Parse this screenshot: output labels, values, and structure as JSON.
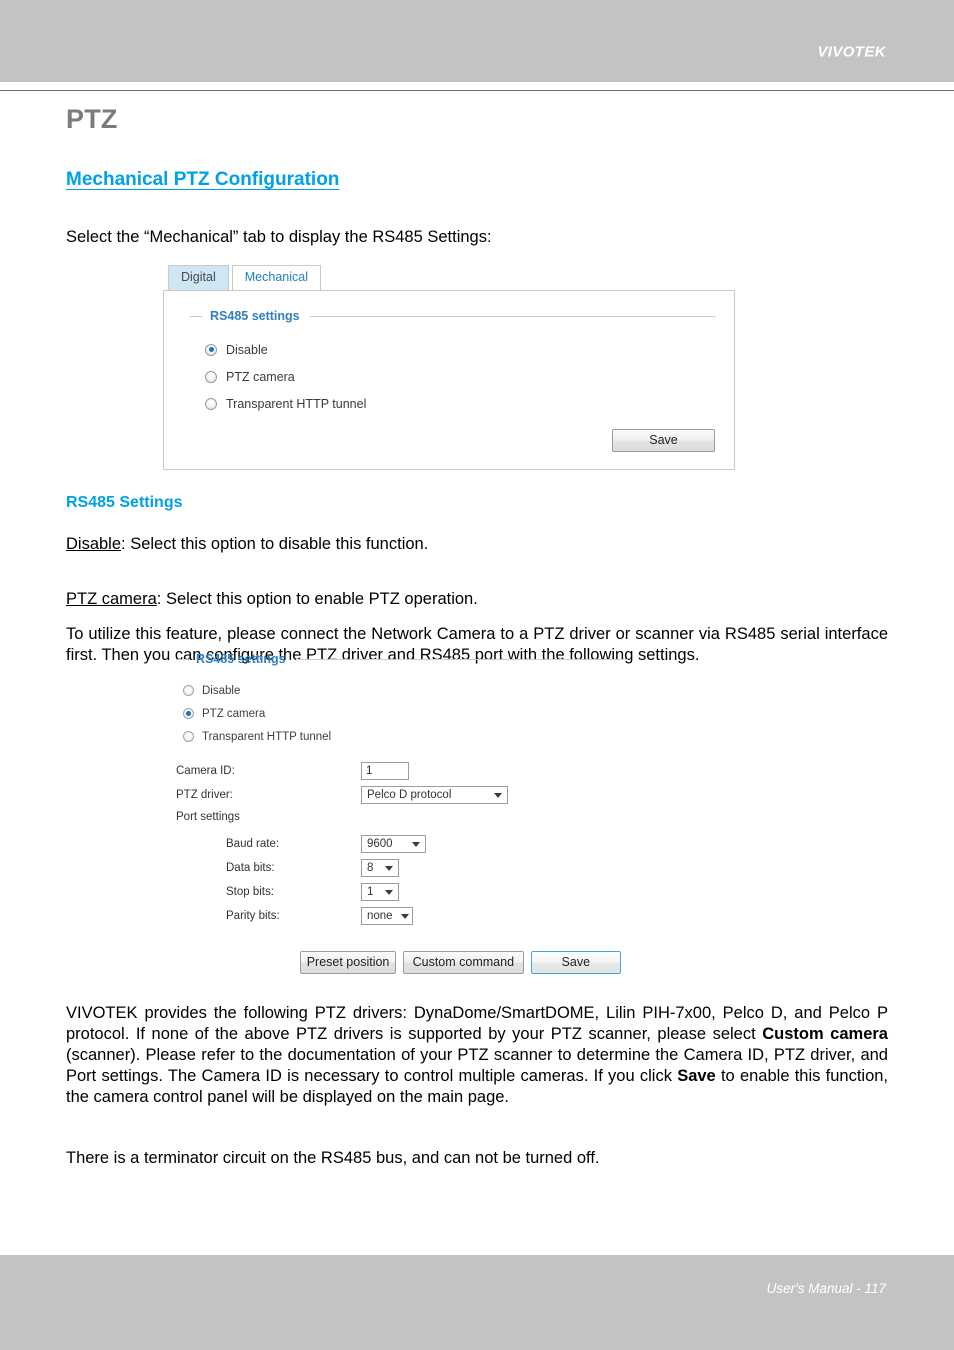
{
  "header": {
    "brand": "VIVOTEK"
  },
  "footer": {
    "text": "User's Manual - 117"
  },
  "content": {
    "page_title": "PTZ",
    "section_link": "Mechanical PTZ Configuration",
    "intro_text": "Select the “Mechanical” tab to display the RS485 Settings:",
    "sub_heading": "RS485 Settings",
    "para_disable_term": "Disable",
    "para_disable_rest": ": Select this option to disable this function.",
    "para_ptz_term": "PTZ camera",
    "para_ptz_rest": ": Select this option to enable PTZ operation.",
    "para_ptz_cont": "To utilize this feature, please connect the Network Camera to a PTZ driver or scanner via RS485 serial interface first. Then you can configure the PTZ driver and RS485 port with the following settings.",
    "para_drivers_1": "VIVOTEK provides the following PTZ drivers: DynaDome/SmartDOME, Lilin PIH-7x00, Pelco D, and Pelco P protocol. If none of the above PTZ drivers is supported by your PTZ scanner, please select ",
    "para_drivers_bold1": "Custom camera",
    "para_drivers_2": " (scanner). Please refer to the documentation of your PTZ scanner to determine the Camera ID, PTZ driver, and Port settings. The Camera ID is necessary to control multiple cameras. If you click ",
    "para_drivers_bold2": "Save",
    "para_drivers_3": " to enable this function, the camera control panel will be displayed on the main page.",
    "para_terminator": "There is a terminator circuit on the RS485 bus, and can not be turned off."
  },
  "widget1": {
    "tabs": [
      {
        "label": "Digital",
        "active": false
      },
      {
        "label": "Mechanical",
        "active": true
      }
    ],
    "fieldset_label": "RS485 settings",
    "radios": [
      {
        "label": "Disable",
        "checked": true
      },
      {
        "label": "PTZ camera",
        "checked": false
      },
      {
        "label": "Transparent HTTP tunnel",
        "checked": false
      }
    ],
    "save_label": "Save"
  },
  "widget2": {
    "fieldset_label": "RS485 settings",
    "radios": [
      {
        "label": "Disable",
        "checked": false
      },
      {
        "label": "PTZ camera",
        "checked": true
      },
      {
        "label": "Transparent HTTP tunnel",
        "checked": false
      }
    ],
    "camera_id_label": "Camera ID:",
    "camera_id_value": "1",
    "ptz_driver_label": "PTZ driver:",
    "ptz_driver_value": "Pelco D protocol",
    "port_settings_label": "Port settings",
    "baud_rate_label": "Baud rate:",
    "baud_rate_value": "9600",
    "data_bits_label": "Data bits:",
    "data_bits_value": "8",
    "stop_bits_label": "Stop bits:",
    "stop_bits_value": "1",
    "parity_bits_label": "Parity bits:",
    "parity_bits_value": "none",
    "preset_position_label": "Preset position",
    "custom_command_label": "Custom command",
    "save_label": "Save"
  },
  "colors": {
    "band": "#c2c4c4",
    "accent_blue": "#00a0e9",
    "panel_blue": "#2f7fc1",
    "title_gray": "#7b7b7b"
  }
}
